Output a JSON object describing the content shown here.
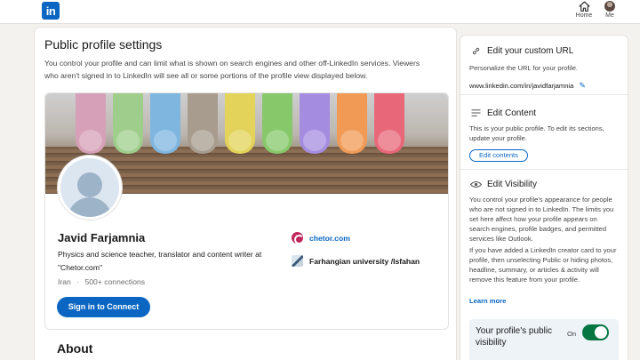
{
  "nav": {
    "logo": "in",
    "home_label": "Home",
    "me_label": "Me"
  },
  "main": {
    "title": "Public profile settings",
    "description": "You control your profile and can limit what is shown on search engines and other off-LinkedIn services. Viewers who aren't signed in to LinkedIn will see all or some portions of the profile view displayed below.",
    "profile": {
      "name": "Javid Farjamnia",
      "headline": "Physics and science teacher, translator and content writer at \"Chetor.com\"",
      "location": "Iran",
      "separator": "·",
      "connections": "500+ connections",
      "signin_label": "Sign in to Connect",
      "company": "chetor.com",
      "education": "Farhangian university /Isfahan"
    },
    "about_title": "About"
  },
  "sidebar": {
    "url_section": {
      "title": "Edit your custom URL",
      "text": "Personalize the URL for your profile.",
      "url": "www.linkedin.com/in/javidfarjamnia"
    },
    "content_section": {
      "title": "Edit Content",
      "text": "This is your public profile. To edit its sections, update your profile.",
      "button": "Edit contents"
    },
    "visibility_section": {
      "title": "Edit Visibility",
      "text1": "You control your profile's appearance for people who are not signed in to LinkedIn. The limits you set here affect how your profile appears on search engines, profile badges, and permitted services like Outlook.",
      "text2": "If you have added a LinkedIn creator card to your profile, then unselecting Public or hiding photos, headline, summary, or articles & activity will remove this feature from your profile.",
      "learn_more": "Learn more",
      "toggle_label": "Your profile's public visibility",
      "toggle_state": "On"
    }
  },
  "colors": {
    "brand": "#0a66c2",
    "toggle_on": "#057642",
    "background": "#f4f2ee"
  },
  "chalk_colors": [
    "#d6a0b8",
    "#9fce8c",
    "#7fb6e0",
    "#a79c8e",
    "#e3d35a",
    "#86c86a",
    "#a48de0",
    "#f09a55",
    "#e8687a"
  ]
}
